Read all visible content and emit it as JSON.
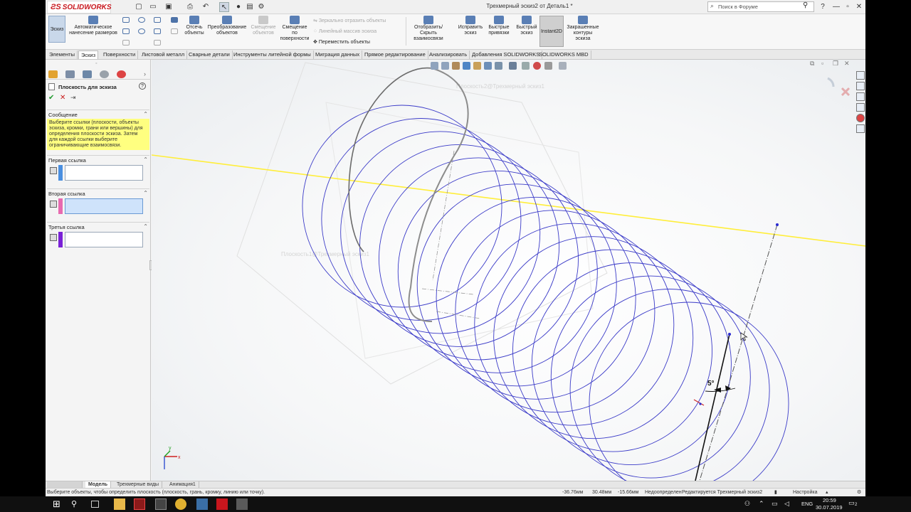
{
  "window": {
    "title": "Трехмерный эскиз2 от Деталь1 *",
    "logo_text": "SOLIDWORKS",
    "search_placeholder": "Поиск в Форуме"
  },
  "command_manager": {
    "sketch": "Эскиз",
    "smart_dimension_1": "Автоматическое",
    "smart_dimension_2": "нанесение размеров",
    "trim_1": "Отсечь",
    "trim_2": "объекты",
    "convert_1": "Преобразование",
    "convert_2": "объектов",
    "offset_entities_1": "Смещение",
    "offset_entities_2": "объектов",
    "offset_surface_1": "Смещение",
    "offset_surface_2": "по",
    "offset_surface_3": "поверхности",
    "mirror": "Зеркально отразить объекты",
    "linear_pattern": "Линейный массив эскиза",
    "move": "Переместить объекты",
    "display_relations_1": "Отобразить/Скрыть",
    "display_relations_2": "взаимосвязи",
    "repair_1": "Исправить",
    "repair_2": "эскиз",
    "quick_snaps_1": "Быстрые",
    "quick_snaps_2": "привязки",
    "rapid_sketch_1": "Быстрый",
    "rapid_sketch_2": "эскиз",
    "instant2d": "Instant2D",
    "shaded_1": "Закрашенные",
    "shaded_2": "контуры",
    "shaded_3": "эскиза"
  },
  "tabs": [
    "Элементы",
    "Эскиз",
    "Поверхности",
    "Листовой металл",
    "Сварные детали",
    "Инструменты литейной формы",
    "Миграция данных",
    "Прямое редактирование",
    "Анализировать",
    "Добавления SOLIDWORKS",
    "SOLIDWORKS MBD"
  ],
  "property_manager": {
    "title": "Плоскость для эскиза",
    "help": "?",
    "message_header": "Сообщение",
    "message": "Выберите ссылки (плоскости, объекты эскиза, кромки, грани или вершины) для определения плоскости эскиза. Затем для каждой ссылки выберите ограничивающие взаимосвязи.",
    "first_ref": "Первая ссылка",
    "second_ref": "Вторая ссылка",
    "third_ref": "Третья ссылка",
    "colors": {
      "first": "#4a8fe0",
      "second": "#e86ab0",
      "third": "#7a22d6"
    }
  },
  "viewport": {
    "ghost_label_1": "Плоскость2@Трехмерный эскиз1",
    "ghost_label_2": "Плоскость1@Трехмерный эскиз1",
    "angle_dim": "5°",
    "colors": {
      "coil": "#3b3bc8",
      "axis": "#ffee3a"
    }
  },
  "bottom_tabs": [
    "Модель",
    "Трехмерные виды",
    "Анимация1"
  ],
  "status": {
    "prompt": "Выберите объекты, чтобы определить плоскость (плоскость, грань, кромку, линию или точку).",
    "x": "-36.76мм",
    "y": "30.48мм",
    "z": "-15.66мм",
    "state": "Недоопределен",
    "editing": "Редактируется Трехмерный эскиз2",
    "custom": "Настройка"
  },
  "taskbar": {
    "lang": "ENG",
    "time": "20:59",
    "date": "30.07.2019",
    "notify_count": "2"
  }
}
